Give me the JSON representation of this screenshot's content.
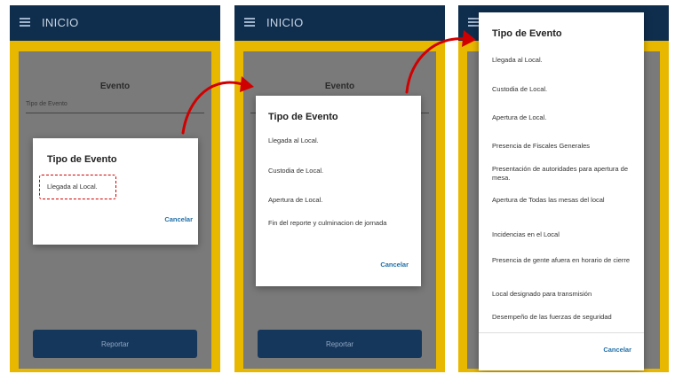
{
  "appbar": {
    "title": "INICIO"
  },
  "form": {
    "title": "Evento",
    "placeholder": "Tipo de Evento",
    "report_label": "Reportar"
  },
  "dialog": {
    "title": "Tipo de Evento",
    "cancel_label": "Cancelar",
    "short_items": [
      "Llegada al Local."
    ],
    "medium_items": [
      "Llegada al Local.",
      "Custodia de Local.",
      "Apertura de Local.",
      "Fin del reporte y culminacion de jornada"
    ],
    "full_items": [
      "Llegada al Local.",
      "Custodia de Local.",
      "Apertura de Local.",
      "Presencia de Fiscales Generales",
      "Presentación de autoridades para apertura de mesa.",
      "Apertura de Todas las mesas del local",
      "Incidencias en el Local",
      "Presencia de gente afuera en horario de cierre",
      "Local designado para transmisión",
      "Desempeño de las fuerzas de seguridad"
    ]
  },
  "colors": {
    "appbar": "#0f2d4d",
    "frame": "#e8b800",
    "accent": "#1f6fa8",
    "arrow": "#d00000"
  },
  "icons": {
    "menu": "menu-icon"
  }
}
